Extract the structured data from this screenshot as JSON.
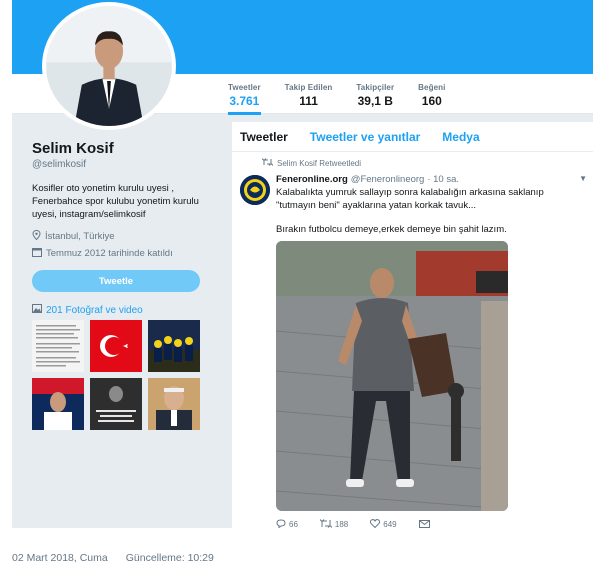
{
  "profile": {
    "name": "Selim Kosif",
    "handle": "@selimkosif",
    "bio": "Kosifler oto yonetim kurulu uyesi , Fenerbahce spor kulubu yonetim kurulu uyesi, instagram/selimkosif",
    "location": "İstanbul, Türkiye",
    "joined": "Temmuz 2012 tarihinde katıldı",
    "tweet_button": "Tweetle",
    "media_link": "201 Fotoğraf ve video"
  },
  "stats": [
    {
      "label": "Tweetler",
      "value": "3.761"
    },
    {
      "label": "Takip Edilen",
      "value": "111"
    },
    {
      "label": "Takipçiler",
      "value": "39,1 B"
    },
    {
      "label": "Beğeni",
      "value": "160"
    }
  ],
  "tabs": [
    "Tweetler",
    "Tweetler ve yanıtlar",
    "Medya"
  ],
  "tweet": {
    "retweet_note": "Selim Kosif Retweetledi",
    "author": "Feneronline.org",
    "handle": "@Feneronlineorg",
    "time": "· 10 sa.",
    "text": "Kalabalıkta yumruk sallayıp sonra kalabalığın arkasına saklanıp \"tutmayın beni\" ayaklarına yatan korkak tavuk...",
    "text2": "Bırakın futbolcu demeye,erkek demeye bin şahit lazım.",
    "replies": "66",
    "retweets": "188",
    "likes": "649"
  },
  "footer": {
    "date": "02 Mart 2018, Cuma",
    "updated": "Güncelleme: 10:29"
  },
  "colors": {
    "accent": "#1da1f2",
    "background": "#e6ecf0",
    "muted": "#657786"
  }
}
